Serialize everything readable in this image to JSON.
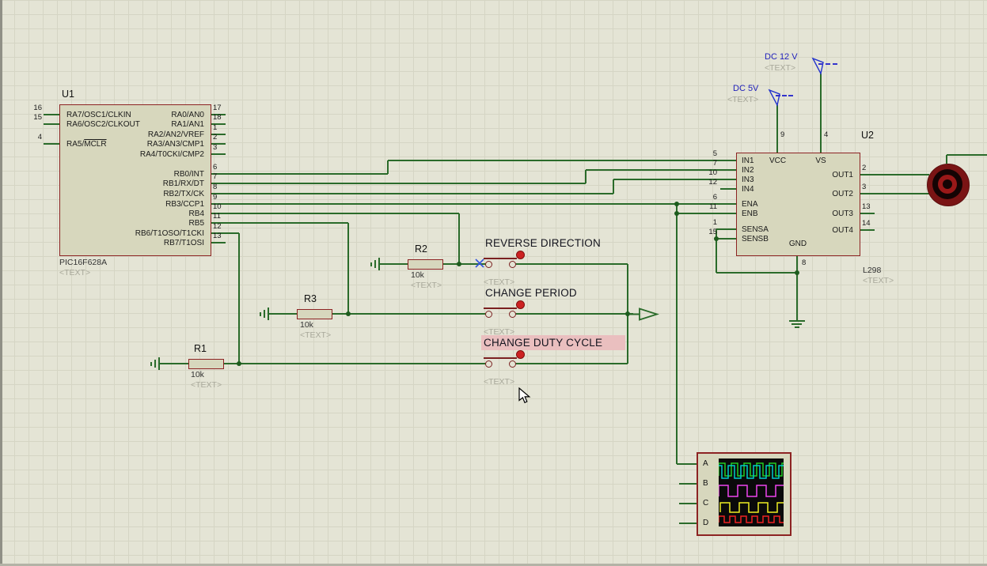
{
  "colors": {
    "wire": "#2a6b2a",
    "component_outline": "#8d2323",
    "component_fill": "#d7d7bd",
    "canvas": "#e4e4d5",
    "grid": "#d5d5c4",
    "power_label": "#2222bb",
    "placeholder_text": "#a8a89a",
    "selection_highlight": "#eabfbf",
    "actuator_red": "#cc2222",
    "scope_screen": "#0a0a0a"
  },
  "u1": {
    "ref": "U1",
    "part": "PIC16F628A",
    "placeholder": "<TEXT>",
    "left_pins": [
      {
        "num": "16",
        "name": "RA7/OSC1/CLKIN"
      },
      {
        "num": "15",
        "name": "RA6/OSC2/CLKOUT"
      },
      {
        "num": "4",
        "name_prefix": "RA5/",
        "name_overline": "MCLR"
      }
    ],
    "right_pins_top": [
      {
        "num": "17",
        "name": "RA0/AN0"
      },
      {
        "num": "18",
        "name": "RA1/AN1"
      },
      {
        "num": "1",
        "name": "RA2/AN2/VREF"
      },
      {
        "num": "2",
        "name": "RA3/AN3/CMP1"
      },
      {
        "num": "3",
        "name": "RA4/T0CKI/CMP2"
      }
    ],
    "right_pins_bottom": [
      {
        "num": "6",
        "name": "RB0/INT"
      },
      {
        "num": "7",
        "name": "RB1/RX/DT"
      },
      {
        "num": "8",
        "name": "RB2/TX/CK"
      },
      {
        "num": "9",
        "name": "RB3/CCP1"
      },
      {
        "num": "10",
        "name": "RB4"
      },
      {
        "num": "11",
        "name": "RB5"
      },
      {
        "num": "12",
        "name": "RB6/T1OSO/T1CKI"
      },
      {
        "num": "13",
        "name": "RB7/T1OSI"
      }
    ]
  },
  "u2": {
    "ref": "U2",
    "part": "L298",
    "placeholder": "<TEXT>",
    "left_pins": [
      {
        "num": "5",
        "name": "IN1"
      },
      {
        "num": "7",
        "name": "IN2"
      },
      {
        "num": "10",
        "name": "IN3"
      },
      {
        "num": "12",
        "name": "IN4"
      },
      {
        "num": "6",
        "name": "ENA"
      },
      {
        "num": "11",
        "name": "ENB"
      },
      {
        "num": "1",
        "name": "SENSA"
      },
      {
        "num": "15",
        "name": "SENSB"
      }
    ],
    "right_pins": [
      {
        "num": "2",
        "name": "OUT1"
      },
      {
        "num": "3",
        "name": "OUT2"
      },
      {
        "num": "13",
        "name": "OUT3"
      },
      {
        "num": "14",
        "name": "OUT4"
      }
    ],
    "top_pins": [
      {
        "num": "9",
        "name": "VCC"
      },
      {
        "num": "4",
        "name": "VS"
      }
    ],
    "bottom_pins": [
      {
        "num": "8",
        "name": "GND"
      }
    ]
  },
  "resistors": {
    "r1": {
      "ref": "R1",
      "value": "10k",
      "placeholder": "<TEXT>"
    },
    "r2": {
      "ref": "R2",
      "value": "10k",
      "placeholder": "<TEXT>"
    },
    "r3": {
      "ref": "R3",
      "value": "10k",
      "placeholder": "<TEXT>"
    }
  },
  "buttons": [
    {
      "label": "REVERSE DIRECTION",
      "placeholder": "<TEXT>"
    },
    {
      "label": "CHANGE PERIOD",
      "placeholder": "<TEXT>"
    },
    {
      "label": "CHANGE DUTY CYCLE",
      "placeholder": "<TEXT>"
    }
  ],
  "power_terminals": [
    {
      "label": "DC 12 V",
      "placeholder": "<TEXT>"
    },
    {
      "label": "DC 5V",
      "placeholder": "<TEXT>"
    }
  ],
  "oscilloscope": {
    "channels": [
      "A",
      "B",
      "C",
      "D"
    ],
    "traces": [
      {
        "name": "trace-green",
        "color": "#22cc22"
      },
      {
        "name": "trace-cyan",
        "color": "#00cccc"
      },
      {
        "name": "trace-magenta",
        "color": "#ee44ee"
      },
      {
        "name": "trace-yellow",
        "color": "#eeee22"
      },
      {
        "name": "trace-red",
        "color": "#ee2222"
      }
    ]
  }
}
